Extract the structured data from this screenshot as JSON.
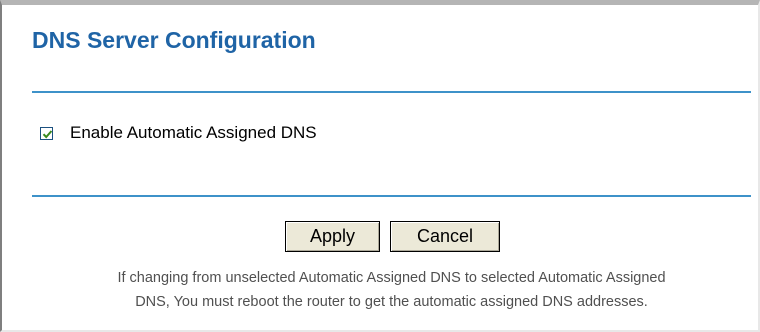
{
  "page": {
    "title": "DNS Server Configuration"
  },
  "options": {
    "auto_dns": {
      "label": "Enable Automatic Assigned DNS",
      "checked": true
    }
  },
  "actions": {
    "apply_label": "Apply",
    "cancel_label": "Cancel"
  },
  "note": {
    "line1": "If changing from unselected Automatic Assigned DNS to selected Automatic Assigned",
    "line2": "DNS, You must reboot the router to get the automatic assigned DNS addresses."
  },
  "colors": {
    "title": "#1f64a6",
    "divider": "#3e92c9",
    "checkmark": "#3a8a1e"
  }
}
